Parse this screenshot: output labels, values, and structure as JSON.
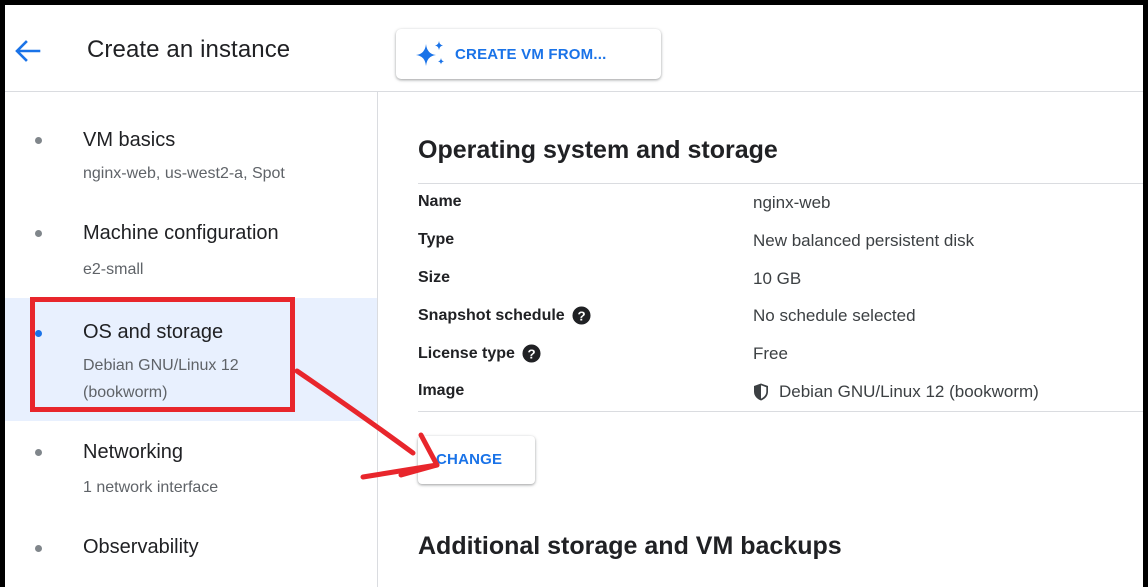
{
  "header": {
    "title": "Create an instance",
    "create_vm_label": "CREATE VM FROM..."
  },
  "sidebar": {
    "items": [
      {
        "title": "VM basics",
        "subtitle_lines": [
          "nginx-web, us-west2-a, Spot"
        ],
        "active": false
      },
      {
        "title": "Machine configuration",
        "subtitle_lines": [
          "e2-small"
        ],
        "active": false
      },
      {
        "title": "OS and storage",
        "subtitle_lines": [
          "Debian GNU/Linux 12",
          "(bookworm)"
        ],
        "active": true
      },
      {
        "title": "Networking",
        "subtitle_lines": [
          "1 network interface"
        ],
        "active": false
      },
      {
        "title": "Observability",
        "subtitle_lines": [],
        "active": false
      }
    ]
  },
  "main": {
    "section_title": "Operating system and storage",
    "details": [
      {
        "label": "Name",
        "value": "nginx-web",
        "help": false,
        "value_icon": null
      },
      {
        "label": "Type",
        "value": "New balanced persistent disk",
        "help": false,
        "value_icon": null
      },
      {
        "label": "Size",
        "value": "10 GB",
        "help": false,
        "value_icon": null
      },
      {
        "label": "Snapshot schedule",
        "value": "No schedule selected",
        "help": true,
        "value_icon": null
      },
      {
        "label": "License type",
        "value": "Free",
        "help": true,
        "value_icon": null
      },
      {
        "label": "Image",
        "value": "Debian GNU/Linux 12 (bookworm)",
        "help": false,
        "value_icon": "shield-icon"
      }
    ],
    "change_label": "CHANGE",
    "next_section_title": "Additional storage and VM backups"
  },
  "icons": {
    "back": "arrow-back-icon",
    "sparkle": "sparkle-icon",
    "help": "help-circle-icon",
    "shield": "shield-icon"
  },
  "colors": {
    "accent": "#1a73e8",
    "active_bg": "#e8f0fe",
    "annotation_red": "#e8262c"
  }
}
